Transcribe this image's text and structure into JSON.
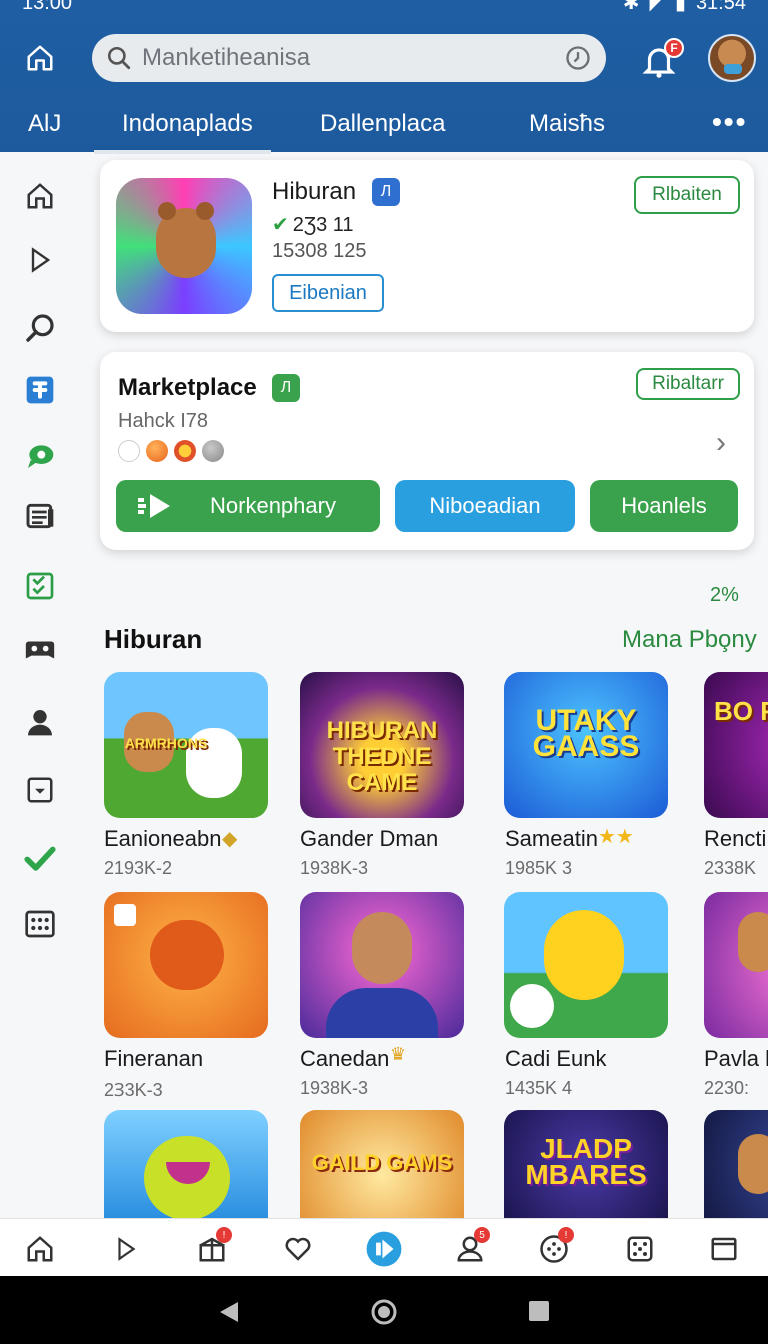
{
  "status": {
    "time": "13:00",
    "clock_right": "31:54"
  },
  "search": {
    "placeholder": "Manketiheanisa"
  },
  "notifications": {
    "badge": "F"
  },
  "tabs": [
    "AlJ",
    "Indonaplads",
    "Dallenplaca",
    "Maisħs"
  ],
  "featured": {
    "title": "Hiburan",
    "chip": "Л",
    "rating": "2Ʒ3 11",
    "count": "15308 125",
    "outline_button": "Eibenian",
    "action_button": "Rlbaiten"
  },
  "marketplace": {
    "title": "Marketplace",
    "chip": "Л",
    "subtitle": "Hahck I78",
    "action_button": "Ribaltarr",
    "buttons": [
      "Norkenphary",
      "Niboeadian",
      "Hoanlels"
    ],
    "colors": {
      "green": "#3aa24c",
      "blue": "#2a9fdf"
    }
  },
  "section": {
    "percent": "2%",
    "title": "Hiburan",
    "more": "Mana Pbo̧ny"
  },
  "tiles": [
    {
      "title": "Eanioneabn",
      "sub": "2193K-2",
      "art": "ARMRHONS"
    },
    {
      "title": "Gander Dman",
      "sub": "1938K-3",
      "art": "HIBURAN THEDNE CAME"
    },
    {
      "title": "Sameatin",
      "sub": "1985K 3",
      "art": "UTAKY GAASS"
    },
    {
      "title": "Rencti",
      "sub": "2338K",
      "art": "BO FI"
    },
    {
      "title": "Fineranan",
      "sub": "2Ɜ3K-3",
      "art": ""
    },
    {
      "title": "Canedan",
      "sub": "1938K-3",
      "art": ""
    },
    {
      "title": "Cadi Eunk",
      "sub": "1435K 4",
      "art": ""
    },
    {
      "title": "Pavla k",
      "sub": "2230:",
      "art": ""
    },
    {
      "title": "",
      "sub": "",
      "art": ""
    },
    {
      "title": "",
      "sub": "",
      "art": "GAILD GAMS"
    },
    {
      "title": "",
      "sub": "",
      "art": "JLADP MBARES"
    },
    {
      "title": "",
      "sub": "",
      "art": ""
    }
  ],
  "icons": {
    "sidebar": [
      "home-icon",
      "play-icon",
      "search-icon",
      "puzzle-icon",
      "chat-icon",
      "news-icon",
      "checklist-icon",
      "gamepad-icon",
      "person-icon",
      "download-box-icon",
      "check-icon",
      "dice-grid-icon"
    ],
    "bottom": [
      "home-icon",
      "play-icon",
      "gift-icon",
      "heart-icon",
      "forward-icon",
      "profile-icon",
      "game-controller-icon",
      "dice-icon",
      "window-icon"
    ]
  },
  "bottom_badges": {
    "gift": "!",
    "profile": "5",
    "game": "!"
  }
}
